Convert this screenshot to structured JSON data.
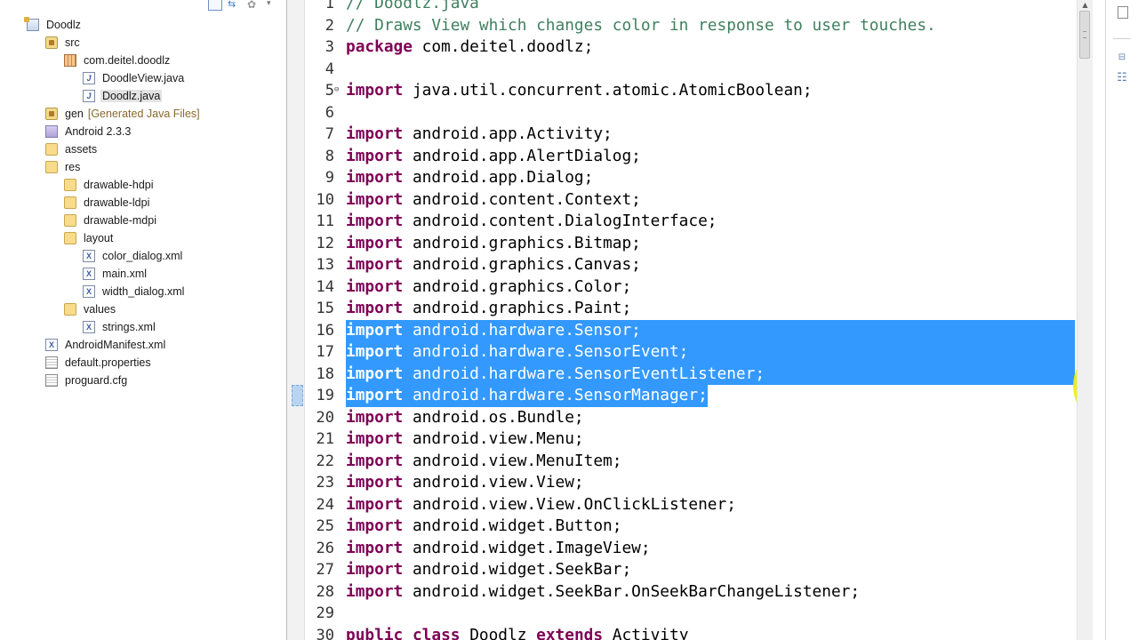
{
  "explorer": {
    "items": [
      {
        "label": "Doodlz",
        "decor": "",
        "indent": 0,
        "icon": "project-icon",
        "iconClass": "project",
        "glyph": ""
      },
      {
        "label": "src",
        "decor": "",
        "indent": 1,
        "icon": "source-folder-icon",
        "iconClass": "srcfolder",
        "glyph": ""
      },
      {
        "label": "com.deitel.doodlz",
        "decor": "",
        "indent": 2,
        "icon": "package-icon",
        "iconClass": "package",
        "glyph": ""
      },
      {
        "label": "DoodleView.java",
        "decor": "",
        "indent": 3,
        "icon": "java-file-icon",
        "iconClass": "javafile",
        "glyph": "J"
      },
      {
        "label": "Doodlz.java",
        "decor": "",
        "indent": 3,
        "icon": "java-file-icon",
        "iconClass": "javafile",
        "glyph": "J",
        "selected": true
      },
      {
        "label": "gen",
        "decor": "[Generated Java Files]",
        "indent": 1,
        "icon": "source-folder-icon",
        "iconClass": "srcfolder",
        "glyph": ""
      },
      {
        "label": "Android 2.3.3",
        "decor": "",
        "indent": 1,
        "icon": "library-icon",
        "iconClass": "libfile",
        "glyph": ""
      },
      {
        "label": "assets",
        "decor": "",
        "indent": 1,
        "icon": "folder-icon",
        "iconClass": "folder",
        "glyph": ""
      },
      {
        "label": "res",
        "decor": "",
        "indent": 1,
        "icon": "folder-icon",
        "iconClass": "folder",
        "glyph": ""
      },
      {
        "label": "drawable-hdpi",
        "decor": "",
        "indent": 2,
        "icon": "folder-icon",
        "iconClass": "folder",
        "glyph": ""
      },
      {
        "label": "drawable-ldpi",
        "decor": "",
        "indent": 2,
        "icon": "folder-icon",
        "iconClass": "folder",
        "glyph": ""
      },
      {
        "label": "drawable-mdpi",
        "decor": "",
        "indent": 2,
        "icon": "folder-icon",
        "iconClass": "folder",
        "glyph": ""
      },
      {
        "label": "layout",
        "decor": "",
        "indent": 2,
        "icon": "folder-icon",
        "iconClass": "folder",
        "glyph": ""
      },
      {
        "label": "color_dialog.xml",
        "decor": "",
        "indent": 3,
        "icon": "xml-file-icon",
        "iconClass": "xmlfile",
        "glyph": "X"
      },
      {
        "label": "main.xml",
        "decor": "",
        "indent": 3,
        "icon": "xml-file-icon",
        "iconClass": "xmlfile",
        "glyph": "X"
      },
      {
        "label": "width_dialog.xml",
        "decor": "",
        "indent": 3,
        "icon": "xml-file-icon",
        "iconClass": "xmlfile",
        "glyph": "X"
      },
      {
        "label": "values",
        "decor": "",
        "indent": 2,
        "icon": "folder-icon",
        "iconClass": "folder",
        "glyph": ""
      },
      {
        "label": "strings.xml",
        "decor": "",
        "indent": 3,
        "icon": "xml-file-icon",
        "iconClass": "xmlfile",
        "glyph": "X"
      },
      {
        "label": "AndroidManifest.xml",
        "decor": "",
        "indent": 1,
        "icon": "xml-file-icon",
        "iconClass": "xmlfile",
        "glyph": "X"
      },
      {
        "label": "default.properties",
        "decor": "",
        "indent": 1,
        "icon": "text-file-icon",
        "iconClass": "textfile",
        "glyph": ""
      },
      {
        "label": "proguard.cfg",
        "decor": "",
        "indent": 1,
        "icon": "text-file-icon",
        "iconClass": "textfile",
        "glyph": ""
      }
    ]
  },
  "editor": {
    "lines": [
      {
        "n": "1",
        "fold": "",
        "segs": [
          {
            "t": "// Doodlz.java",
            "c": "cm"
          }
        ]
      },
      {
        "n": "2",
        "fold": "",
        "segs": [
          {
            "t": "// Draws View which changes color in response to user touches.",
            "c": "cm"
          }
        ]
      },
      {
        "n": "3",
        "fold": "",
        "segs": [
          {
            "t": "package",
            "c": "kw"
          },
          {
            "t": " com.deitel.doodlz;",
            "c": ""
          }
        ]
      },
      {
        "n": "4",
        "fold": "",
        "segs": []
      },
      {
        "n": "5",
        "fold": "⊖",
        "segs": [
          {
            "t": "import",
            "c": "kw"
          },
          {
            "t": " java.util.concurrent.atomic.AtomicBoolean;",
            "c": ""
          }
        ]
      },
      {
        "n": "6",
        "fold": "",
        "segs": []
      },
      {
        "n": "7",
        "fold": "",
        "segs": [
          {
            "t": "import",
            "c": "kw"
          },
          {
            "t": " android.app.Activity;",
            "c": ""
          }
        ]
      },
      {
        "n": "8",
        "fold": "",
        "segs": [
          {
            "t": "import",
            "c": "kw"
          },
          {
            "t": " android.app.AlertDialog;",
            "c": ""
          }
        ]
      },
      {
        "n": "9",
        "fold": "",
        "segs": [
          {
            "t": "import",
            "c": "kw"
          },
          {
            "t": " android.app.Dialog;",
            "c": ""
          }
        ]
      },
      {
        "n": "10",
        "fold": "",
        "segs": [
          {
            "t": "import",
            "c": "kw"
          },
          {
            "t": " android.content.Context;",
            "c": ""
          }
        ]
      },
      {
        "n": "11",
        "fold": "",
        "segs": [
          {
            "t": "import",
            "c": "kw"
          },
          {
            "t": " android.content.DialogInterface;",
            "c": ""
          }
        ]
      },
      {
        "n": "12",
        "fold": "",
        "segs": [
          {
            "t": "import",
            "c": "kw"
          },
          {
            "t": " android.graphics.Bitmap;",
            "c": ""
          }
        ]
      },
      {
        "n": "13",
        "fold": "",
        "segs": [
          {
            "t": "import",
            "c": "kw"
          },
          {
            "t": " android.graphics.Canvas;",
            "c": ""
          }
        ]
      },
      {
        "n": "14",
        "fold": "",
        "segs": [
          {
            "t": "import",
            "c": "kw"
          },
          {
            "t": " android.graphics.Color;",
            "c": ""
          }
        ]
      },
      {
        "n": "15",
        "fold": "",
        "segs": [
          {
            "t": "import",
            "c": "kw"
          },
          {
            "t": " android.graphics.Paint;",
            "c": ""
          }
        ]
      },
      {
        "n": "16",
        "fold": "",
        "hl": true,
        "segs": [
          {
            "t": "import",
            "c": "kw"
          },
          {
            "t": " android.hardware.Sensor;",
            "c": ""
          }
        ]
      },
      {
        "n": "17",
        "fold": "",
        "hl": true,
        "segs": [
          {
            "t": "import",
            "c": "kw"
          },
          {
            "t": " android.hardware.SensorEvent;",
            "c": ""
          }
        ]
      },
      {
        "n": "18",
        "fold": "",
        "hl": true,
        "segs": [
          {
            "t": "import",
            "c": "kw"
          },
          {
            "t": " android.hardware.SensorEventListener;",
            "c": ""
          }
        ]
      },
      {
        "n": "19",
        "fold": "",
        "hl": true,
        "last": true,
        "segs": [
          {
            "t": "import",
            "c": "kw"
          },
          {
            "t": " android.hardware.SensorManager;",
            "c": ""
          }
        ]
      },
      {
        "n": "20",
        "fold": "",
        "segs": [
          {
            "t": "import",
            "c": "kw"
          },
          {
            "t": " android.os.Bundle;",
            "c": ""
          }
        ]
      },
      {
        "n": "21",
        "fold": "",
        "segs": [
          {
            "t": "import",
            "c": "kw"
          },
          {
            "t": " android.view.Menu;",
            "c": ""
          }
        ]
      },
      {
        "n": "22",
        "fold": "",
        "segs": [
          {
            "t": "import",
            "c": "kw"
          },
          {
            "t": " android.view.MenuItem;",
            "c": ""
          }
        ]
      },
      {
        "n": "23",
        "fold": "",
        "segs": [
          {
            "t": "import",
            "c": "kw"
          },
          {
            "t": " android.view.View;",
            "c": ""
          }
        ]
      },
      {
        "n": "24",
        "fold": "",
        "segs": [
          {
            "t": "import",
            "c": "kw"
          },
          {
            "t": " android.view.View.OnClickListener;",
            "c": ""
          }
        ]
      },
      {
        "n": "25",
        "fold": "",
        "segs": [
          {
            "t": "import",
            "c": "kw"
          },
          {
            "t": " android.widget.Button;",
            "c": ""
          }
        ]
      },
      {
        "n": "26",
        "fold": "",
        "segs": [
          {
            "t": "import",
            "c": "kw"
          },
          {
            "t": " android.widget.ImageView;",
            "c": ""
          }
        ]
      },
      {
        "n": "27",
        "fold": "",
        "segs": [
          {
            "t": "import",
            "c": "kw"
          },
          {
            "t": " android.widget.SeekBar;",
            "c": ""
          }
        ]
      },
      {
        "n": "28",
        "fold": "",
        "segs": [
          {
            "t": "import",
            "c": "kw"
          },
          {
            "t": " android.widget.SeekBar.OnSeekBarChangeListener;",
            "c": ""
          }
        ]
      },
      {
        "n": "29",
        "fold": "",
        "segs": []
      },
      {
        "n": "30",
        "fold": "",
        "segs": [
          {
            "t": "public",
            "c": "kw"
          },
          {
            "t": " ",
            "c": ""
          },
          {
            "t": "class",
            "c": "kw"
          },
          {
            "t": " Doodlz ",
            "c": ""
          },
          {
            "t": "extends",
            "c": "kw"
          },
          {
            "t": " Activity",
            "c": ""
          }
        ]
      }
    ]
  },
  "colors": {
    "selection": "#3399ff",
    "keyword": "#7f0055",
    "comment": "#3f7f5f",
    "cursor_highlight": "#eeee00"
  }
}
